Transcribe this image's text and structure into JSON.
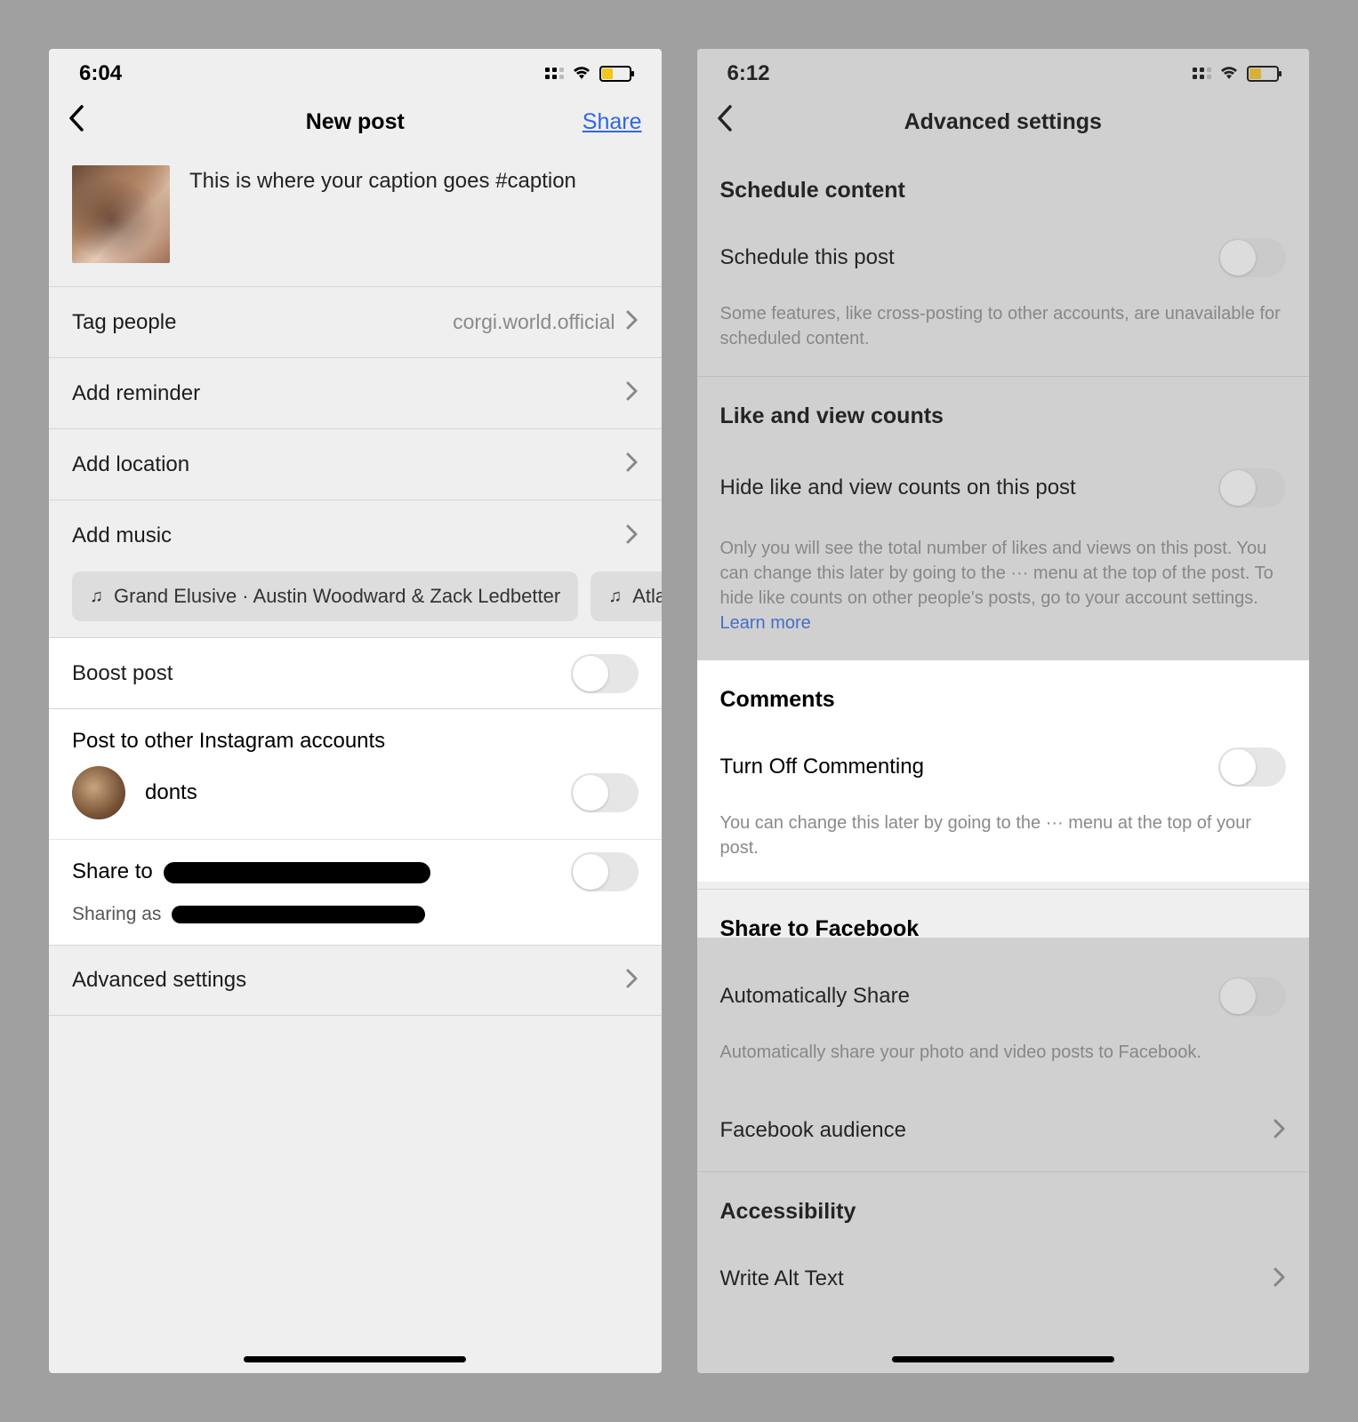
{
  "left": {
    "status_time": "6:04",
    "nav_title": "New post",
    "share_label": "Share",
    "caption": "This is where your caption goes #caption",
    "rows": {
      "tag_people": {
        "label": "Tag people",
        "value": "corgi.world.official"
      },
      "add_reminder": {
        "label": "Add reminder"
      },
      "add_location": {
        "label": "Add location"
      },
      "add_music": {
        "label": "Add music"
      },
      "boost_post": {
        "label": "Boost post"
      },
      "post_other": {
        "label": "Post to other Instagram accounts"
      },
      "account_name": "donts",
      "share_to_prefix": "Share to",
      "sharing_as_prefix": "Sharing as",
      "advanced": {
        "label": "Advanced settings"
      }
    },
    "music_chips": [
      "Grand Elusive · Austin Woodward & Zack Ledbetter",
      "Atlan"
    ]
  },
  "right": {
    "status_time": "6:12",
    "nav_title": "Advanced settings",
    "sections": {
      "schedule": {
        "header": "Schedule content",
        "toggle_label": "Schedule this post",
        "desc": "Some features, like cross-posting to other accounts, are unavailable for scheduled content."
      },
      "likes": {
        "header": "Like and view counts",
        "toggle_label": "Hide like and view counts on this post",
        "desc": "Only you will see the total number of likes and views on this post. You can change this later by going to the ··· menu at the top of the post. To hide like counts on other people's posts, go to your account settings. ",
        "learn_more": "Learn more"
      },
      "comments": {
        "header": "Comments",
        "toggle_label": "Turn Off Commenting",
        "desc": "You can change this later by going to the ··· menu at the top of your post."
      },
      "facebook": {
        "header": "Share to Facebook",
        "toggle_label": "Automatically Share",
        "desc": "Automatically share your photo and video posts to Facebook.",
        "audience_label": "Facebook audience"
      },
      "accessibility": {
        "header": "Accessibility",
        "alt_label": "Write Alt Text"
      }
    }
  }
}
